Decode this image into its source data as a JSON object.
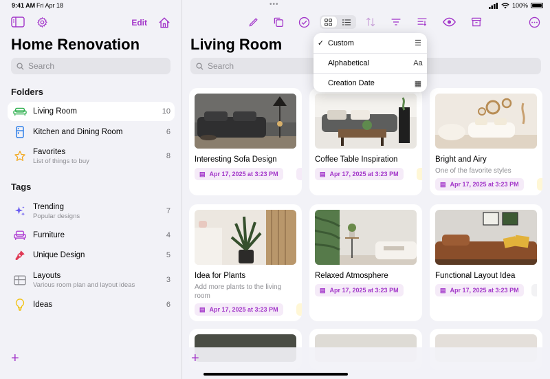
{
  "status": {
    "time": "9:41 AM",
    "date": "Fri Apr 18",
    "battery": "100%"
  },
  "sidebar": {
    "edit_label": "Edit",
    "title": "Home Renovation",
    "search_placeholder": "Search",
    "folders_title": "Folders",
    "folders": [
      {
        "label": "Living Room",
        "sub": "",
        "count": "10",
        "icon": "sofa-icon",
        "selected": true
      },
      {
        "label": "Kitchen and Dining Room",
        "sub": "",
        "count": "6",
        "icon": "fridge-icon"
      },
      {
        "label": "Favorites",
        "sub": "List of things to buy",
        "count": "8",
        "icon": "star-icon"
      }
    ],
    "tags_title": "Tags",
    "tags": [
      {
        "label": "Trending",
        "sub": "Popular designs",
        "count": "7",
        "icon": "sparkles-icon"
      },
      {
        "label": "Furniture",
        "sub": "",
        "count": "4",
        "icon": "armchair-icon"
      },
      {
        "label": "Unique Design",
        "sub": "",
        "count": "5",
        "icon": "paintbrush-icon"
      },
      {
        "label": "Layouts",
        "sub": "Various room plan and layout ideas",
        "count": "3",
        "icon": "grid-layout-icon"
      },
      {
        "label": "Ideas",
        "sub": "",
        "count": "6",
        "icon": "lightbulb-icon"
      }
    ]
  },
  "main": {
    "title": "Living Room",
    "search_placeholder": "Search",
    "sort_menu": [
      {
        "label": "Custom",
        "icon": "list-icon",
        "checked": true
      },
      {
        "label": "Alphabetical",
        "icon": "Aa"
      },
      {
        "label": "Creation Date",
        "icon": "calendar-icon"
      }
    ],
    "cards": [
      {
        "title": "Interesting Sofa Design",
        "sub": "",
        "date": "Apr 17, 2025 at 3:23 PM",
        "image": "dark-sofa-photo"
      },
      {
        "title": "Coffee Table Inspiration",
        "sub": "",
        "date": "Apr 17, 2025 at 3:23 PM",
        "image": "coffee-table-photo"
      },
      {
        "title": "Bright and Airy",
        "sub": "One of the favorite styles",
        "date": "Apr 17, 2025 at 3:23 PM",
        "image": "bright-room-photo"
      },
      {
        "title": "Idea for Plants",
        "sub": "Add more plants to the living room",
        "date": "Apr 17, 2025 at 3:23 PM",
        "image": "plants-photo"
      },
      {
        "title": "Relaxed Atmosphere",
        "sub": "",
        "date": "Apr 17, 2025 at 3:23 PM",
        "image": "relaxed-room-photo"
      },
      {
        "title": "Functional Layout Idea",
        "sub": "",
        "date": "Apr 17, 2025 at 3:23 PM",
        "image": "brown-sofa-photo"
      }
    ]
  },
  "colors": {
    "accent": "#a235c9",
    "tag_bg": "#f5ebf8"
  }
}
